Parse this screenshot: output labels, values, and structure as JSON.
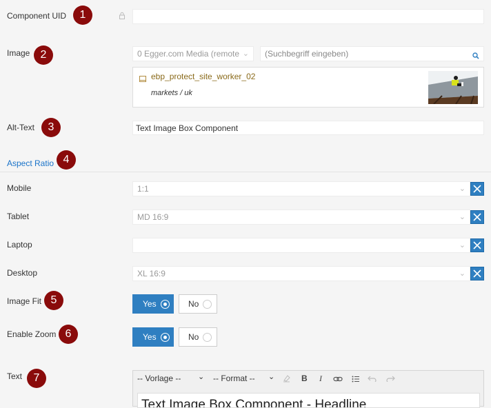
{
  "component_uid": {
    "label": "Component UID",
    "value": "",
    "badge": "1"
  },
  "image": {
    "label": "Image",
    "badge": "2",
    "source_select": "0 Egger.com Media (remote",
    "search_placeholder": "(Suchbegriff eingeben)",
    "file_name": "ebp_protect_site_worker_02",
    "file_path": "markets / uk"
  },
  "alt_text": {
    "label": "Alt-Text",
    "value": "Text Image Box Component",
    "badge": "3"
  },
  "aspect_ratio": {
    "label": "Aspect Ratio",
    "badge": "4"
  },
  "mobile": {
    "label": "Mobile",
    "value": "1:1"
  },
  "tablet": {
    "label": "Tablet",
    "value": "MD 16:9"
  },
  "laptop": {
    "label": "Laptop",
    "value": ""
  },
  "desktop": {
    "label": "Desktop",
    "value": "XL 16:9"
  },
  "image_fit": {
    "label": "Image Fit",
    "badge": "5",
    "yes": "Yes",
    "no": "No",
    "selected": "Yes"
  },
  "enable_zoom": {
    "label": "Enable Zoom",
    "badge": "6",
    "yes": "Yes",
    "no": "No",
    "selected": "Yes"
  },
  "text": {
    "label": "Text",
    "badge": "7",
    "vorlage": "-- Vorlage --",
    "format": "-- Format --",
    "bold": "B",
    "italic": "I",
    "content": "Text Image Box Component - Headline"
  },
  "colors": {
    "accent": "#2f7fc1",
    "badge": "#8a0b0b",
    "link": "#1a73c9"
  }
}
